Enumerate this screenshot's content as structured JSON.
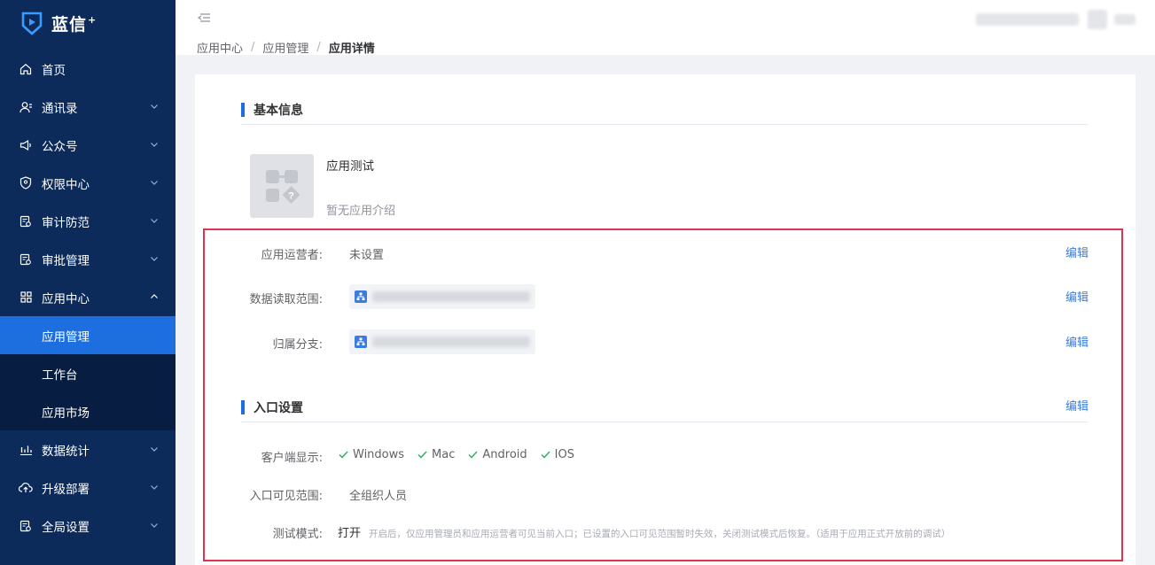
{
  "app": {
    "logo_text": "蓝信",
    "logo_sup": "+"
  },
  "sidebar": {
    "items": [
      {
        "label": "首页",
        "icon": "home-icon",
        "expandable": false
      },
      {
        "label": "通讯录",
        "icon": "contacts-icon",
        "expandable": true
      },
      {
        "label": "公众号",
        "icon": "megaphone-icon",
        "expandable": true
      },
      {
        "label": "权限中心",
        "icon": "shield-icon",
        "expandable": true
      },
      {
        "label": "审计防范",
        "icon": "audit-icon",
        "expandable": true
      },
      {
        "label": "审批管理",
        "icon": "approval-icon",
        "expandable": true
      },
      {
        "label": "应用中心",
        "icon": "grid-icon",
        "expandable": true,
        "expanded": true
      },
      {
        "label": "数据统计",
        "icon": "chart-icon",
        "expandable": true
      },
      {
        "label": "升级部署",
        "icon": "cloud-upload-icon",
        "expandable": true
      },
      {
        "label": "全局设置",
        "icon": "settings-icon",
        "expandable": true
      }
    ],
    "sub_items": [
      {
        "label": "应用管理",
        "active": true
      },
      {
        "label": "工作台",
        "active": false
      },
      {
        "label": "应用市场",
        "active": false
      }
    ]
  },
  "breadcrumb": {
    "items": [
      "应用中心",
      "应用管理"
    ],
    "current": "应用详情"
  },
  "basic": {
    "title": "基本信息",
    "app_name": "应用测试",
    "app_desc": "暂无应用介绍",
    "operator_label": "应用运营者:",
    "operator_value": "未设置",
    "data_scope_label": "数据读取范围:",
    "branch_label": "归属分支:",
    "edit": "编辑"
  },
  "entry": {
    "title": "入口设置",
    "edit": "编辑",
    "clients_label": "客户端显示:",
    "clients": [
      "Windows",
      "Mac",
      "Android",
      "IOS"
    ],
    "visible_label": "入口可见范围:",
    "visible_value": "全组织人员",
    "test_label": "测试模式:",
    "test_value": "打开",
    "test_hint": "开启后，仅应用管理员和应用运营者可见当前入口；已设置的入口可见范围暂时失效，关闭测试模式后恢复。（适用于应用正式开放前的调试）"
  },
  "colors": {
    "sidebar_bg": "#0c2a5a",
    "active_bg": "#1d6fe0",
    "link": "#3b7ddd",
    "highlight_border": "#e0344e",
    "check": "#2fb35a"
  }
}
